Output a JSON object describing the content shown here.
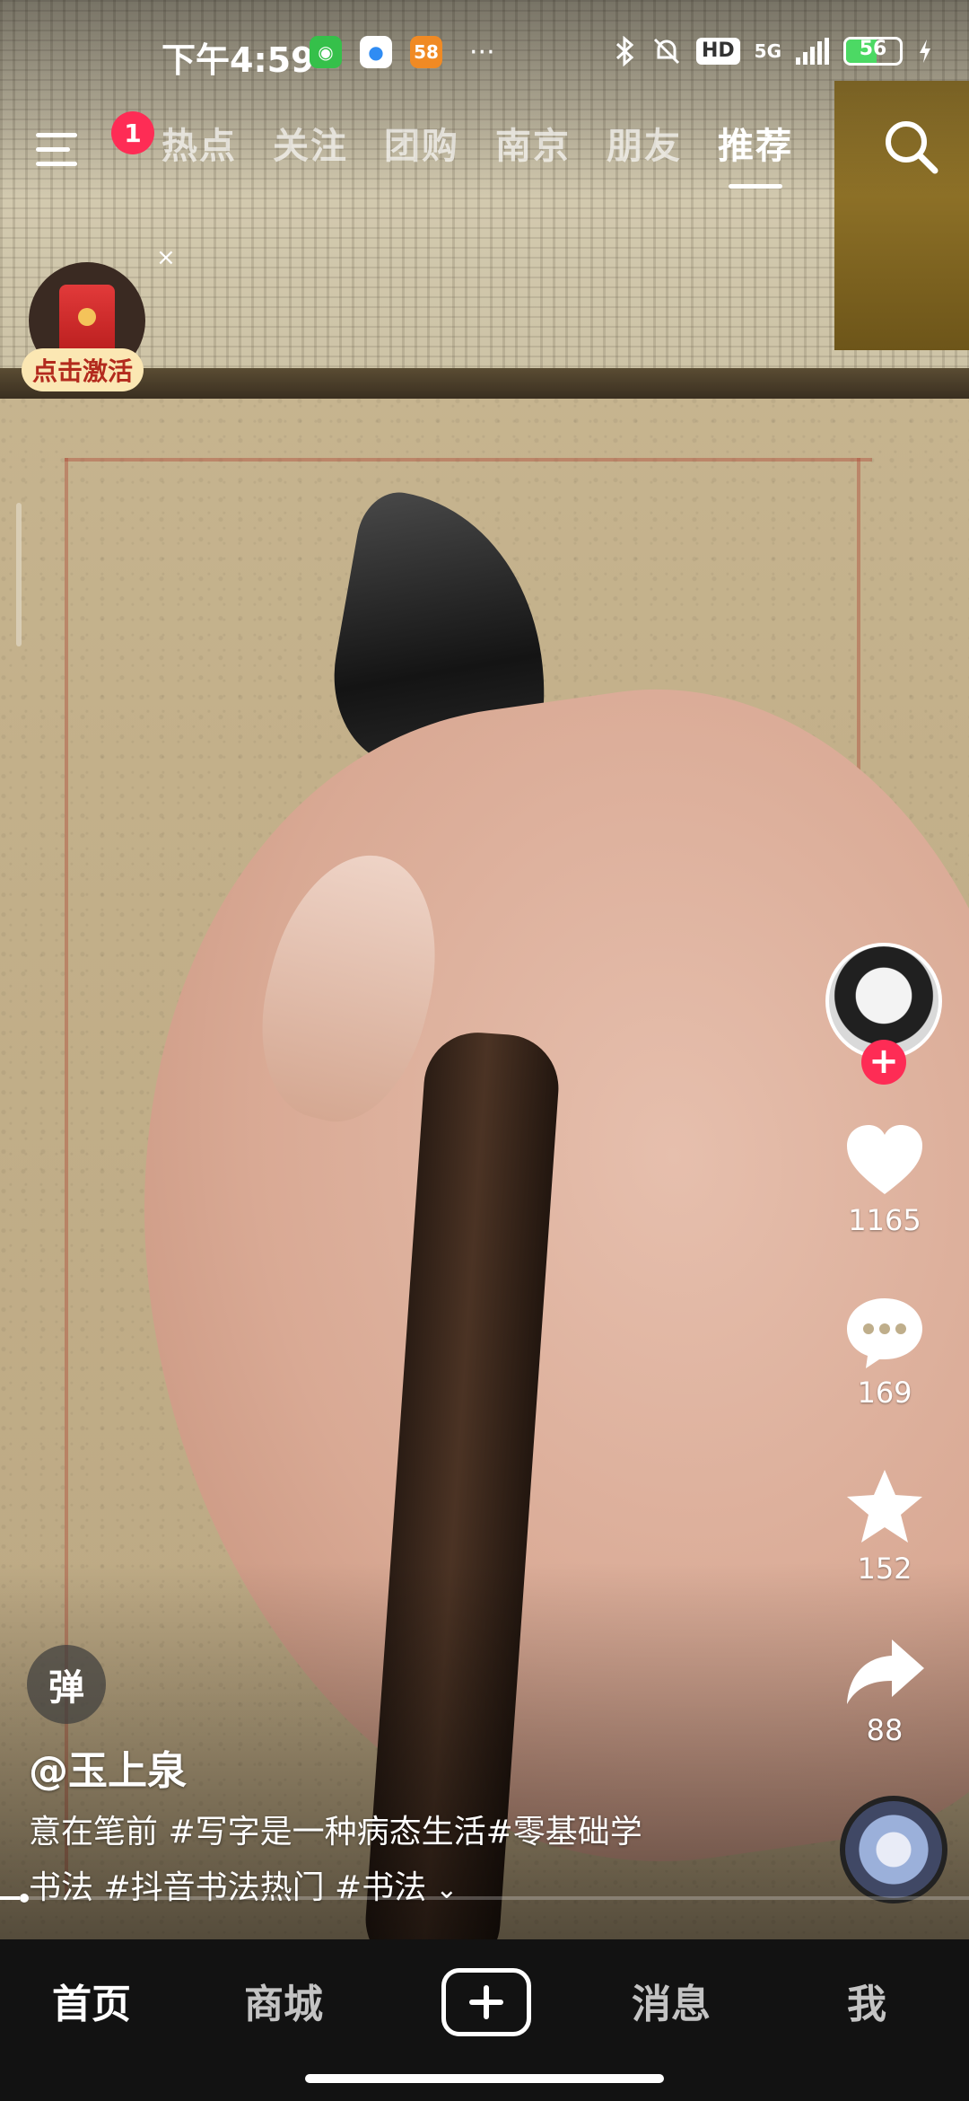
{
  "status_bar": {
    "time": "下午4:59",
    "app_icons": [
      {
        "icon": "android-icon",
        "label": "◉",
        "style": "green"
      },
      {
        "icon": "browser-icon",
        "label": "●",
        "style": "blue"
      },
      {
        "icon": "app-58-icon",
        "label": "58",
        "style": "orange"
      }
    ],
    "more": "···",
    "hd": "HD",
    "network": "5G",
    "battery": "56",
    "battery_level": 0.56
  },
  "top_nav": {
    "menu_badge": "1",
    "tabs": [
      "热点",
      "关注",
      "团购",
      "南京",
      "朋友",
      "推荐"
    ],
    "active_tab_index": 5
  },
  "redpacket": {
    "label": "点击激活",
    "close": "×"
  },
  "rail": {
    "follow": "+",
    "like_count": "1165",
    "comment_count": "169",
    "favorite_count": "152",
    "share_count": "88"
  },
  "post": {
    "danmaku": "弹",
    "author": "@玉上泉",
    "caption_line1": "意在笔前 #写字是一种病态生活#零基础学",
    "caption_line2": "书法 #抖音书法热门 #书法",
    "expand": "⌄",
    "progress": 0.02
  },
  "bottom_nav": {
    "home": "首页",
    "mall": "商城",
    "messages": "消息",
    "me": "我"
  },
  "colors": {
    "accent": "#fe2c55",
    "bottom_bar": "#121212",
    "battery_fill": "#4cd964"
  }
}
